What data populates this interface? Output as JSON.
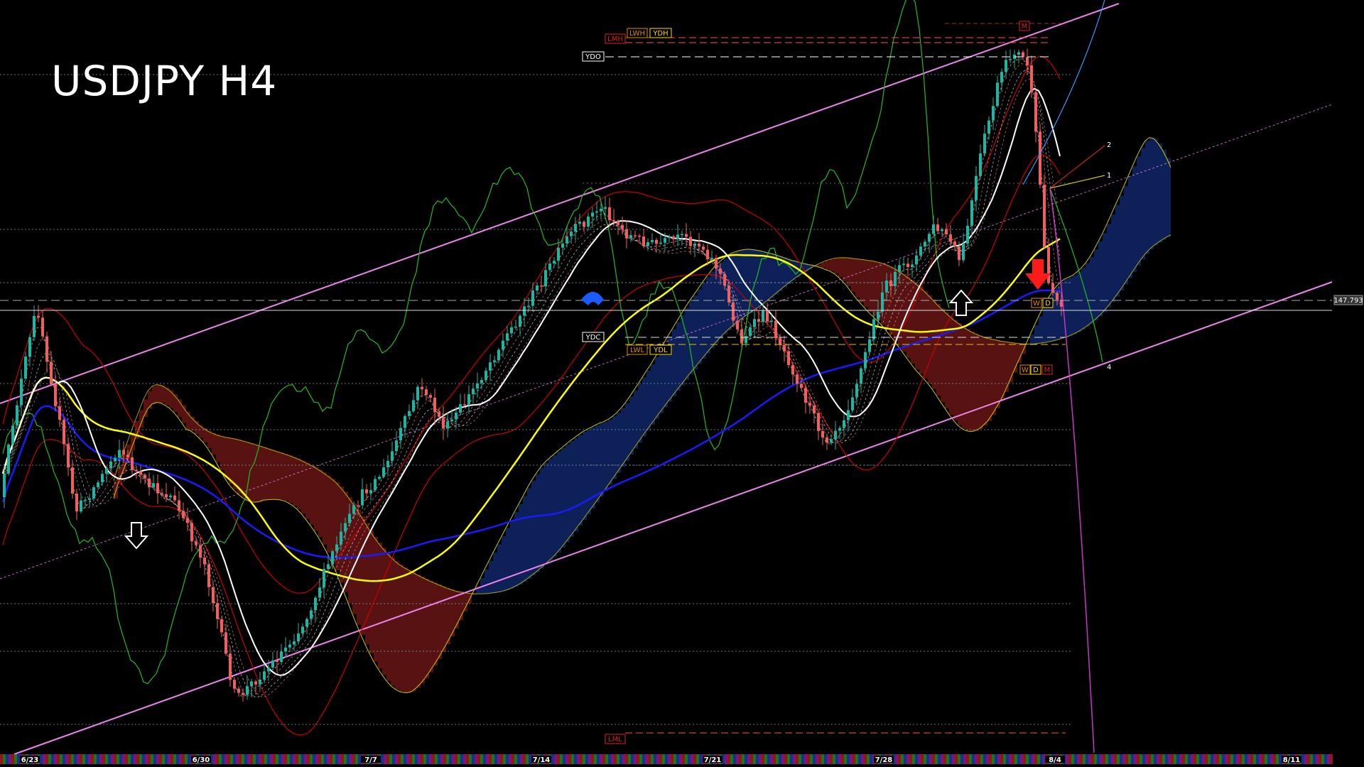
{
  "chart_data": {
    "type": "candlestick",
    "title": "USDJPY H4",
    "x_ticks": [
      "6/23",
      "6/30",
      "7/7",
      "7/14",
      "7/21",
      "7/28",
      "8/4",
      "8/11"
    ],
    "current_price_label": "147.793",
    "level_tags": [
      {
        "label": "LMH",
        "color": "#e02020"
      },
      {
        "label": "LWH",
        "color": "#e08a00"
      },
      {
        "label": "YDH",
        "color": "#ffd700"
      },
      {
        "label": "YDO",
        "color": "#ffffff"
      },
      {
        "label": "YDC",
        "color": "#ffffff"
      },
      {
        "label": "LWL",
        "color": "#e08a00"
      },
      {
        "label": "YDL",
        "color": "#ffd700"
      },
      {
        "label": "LML",
        "color": "#e02020"
      },
      {
        "label": "M",
        "color": "#e02020"
      },
      {
        "label": "W",
        "color": "#e08a00"
      },
      {
        "label": "D",
        "color": "#ffd700"
      },
      {
        "label": "M",
        "color": "#e02020"
      },
      {
        "label": "W",
        "color": "#e08a00"
      },
      {
        "label": "D",
        "color": "#ffd700"
      },
      {
        "label": "W",
        "color": "#e08a00"
      },
      {
        "label": "D",
        "color": "#ffd700"
      }
    ],
    "projection_labels": [
      "2",
      "1",
      "4"
    ],
    "colors": {
      "background": "#000000",
      "bull_candle": "#1fb5a0",
      "bear_candle": "#f06060",
      "channel": "#ee82ee",
      "ma_white": "#ffffff",
      "ma_yellow": "#ffff00",
      "ma_blue": "#1a1aff",
      "bollinger": "#cc0000",
      "chikou": "#22bb22",
      "cloud_bull": "#1a3aa0",
      "cloud_bear": "#a02020"
    }
  }
}
